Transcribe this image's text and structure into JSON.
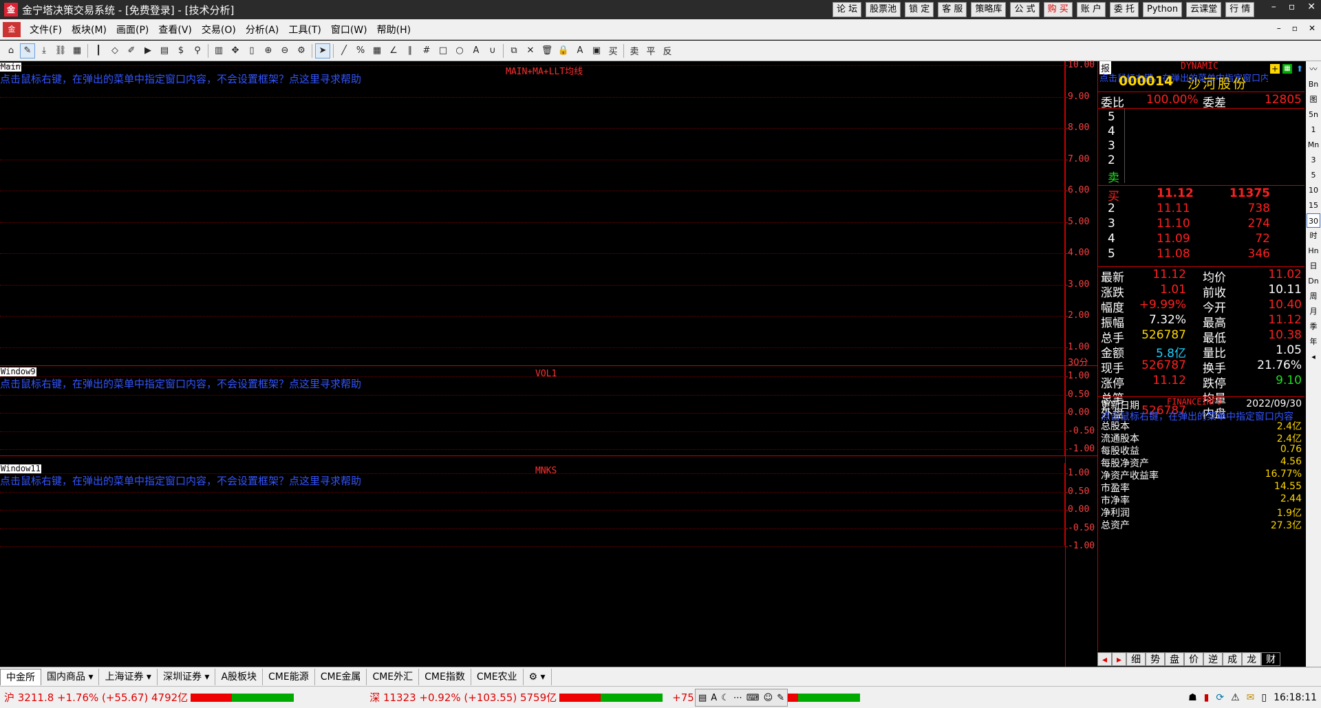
{
  "titlebar": {
    "logo_icon": "app-logo-icon",
    "title": "金宁塔决策交易系统 - [免费登录] - [技术分析]",
    "buttons": [
      "论 坛",
      "股票池",
      "锁 定",
      "客 服",
      "策略库",
      "公 式",
      "购 买",
      "账 户",
      "委 托",
      "Python",
      "云课堂",
      "行 情"
    ],
    "window_controls": [
      "–",
      "▫",
      "✕"
    ]
  },
  "menubar": {
    "items": [
      "文件(F)",
      "板块(M)",
      "画面(P)",
      "查看(V)",
      "交易(O)",
      "分析(A)",
      "工具(T)",
      "窗口(W)",
      "帮助(H)"
    ],
    "controls": [
      "–",
      "▫",
      "✕"
    ]
  },
  "toolbar": {
    "icons": [
      "home-icon",
      "pencil-icon",
      "download-icon",
      "link-icon",
      "grid-icon",
      "candlestick-icon",
      "diamond-icon",
      "edit-icon",
      "play-icon",
      "doc-icon",
      "dollar-icon",
      "filter-icon",
      "table-icon",
      "move-icon",
      "ruler-icon",
      "zoom-in-icon",
      "zoom-out-icon",
      "gear-icon",
      "cursor-icon",
      "line-icon",
      "percent-icon",
      "grid2-icon",
      "angle-icon",
      "parallel-icon",
      "hash-icon",
      "rect-icon",
      "circle-icon",
      "text-icon",
      "magnet-icon",
      "copy-icon",
      "delete-icon",
      "trash-icon",
      "lock-icon",
      "color-icon",
      "save-icon",
      "buy-icon",
      "sell-icon",
      "flat-icon",
      "reverse-icon"
    ],
    "trade_labels": [
      "买",
      "卖",
      "平",
      "反"
    ]
  },
  "chart": {
    "main": {
      "window_label": "Main",
      "hint": "点击鼠标右键，在弹出的菜单中指定窗口内容，不会设置框架？点这里寻求帮助",
      "title": "MAIN+MA+LLT均线",
      "yticks": [
        "10.00",
        "9.00",
        "8.00",
        "7.00",
        "6.00",
        "5.00",
        "4.00",
        "3.00",
        "2.00",
        "1.00"
      ],
      "period": "30分"
    },
    "vol": {
      "window_label": "Window9",
      "hint": "点击鼠标右键，在弹出的菜单中指定窗口内容，不会设置框架？点这里寻求帮助",
      "title": "VOL1",
      "yticks": [
        "1.00",
        "0.50",
        "0.00",
        "-0.50",
        "-1.00"
      ]
    },
    "mnks": {
      "window_label": "Window11",
      "hint": "点击鼠标右键，在弹出的菜单中指定窗口内容，不会设置框架？点这里寻求帮助",
      "title": "MNKS",
      "yticks": [
        "1.00",
        "0.50",
        "0.00",
        "-0.50",
        "-1.00"
      ]
    }
  },
  "quote": {
    "header_label": "DYNAMIC",
    "overlay_hint": "点击鼠标右键，在弹出的菜单中指定窗口内容",
    "code": "000014",
    "name": "沙河股份",
    "weibi_label": "委比",
    "weibi": "100.00%",
    "weicha_label": "委差",
    "weicha": "12805",
    "sell_levels": [
      "5",
      "4",
      "3",
      "2",
      "卖"
    ],
    "buy": [
      {
        "level": "买",
        "price": "11.12",
        "vol": "11375"
      },
      {
        "level": "2",
        "price": "11.11",
        "vol": "738"
      },
      {
        "level": "3",
        "price": "11.10",
        "vol": "274"
      },
      {
        "level": "4",
        "price": "11.09",
        "vol": "72"
      },
      {
        "level": "5",
        "price": "11.08",
        "vol": "346"
      }
    ],
    "stats": [
      {
        "l1": "最新",
        "v1": "11.12",
        "c1": "red",
        "l2": "均价",
        "v2": "11.02",
        "c2": "red"
      },
      {
        "l1": "涨跌",
        "v1": "1.01",
        "c1": "red",
        "l2": "前收",
        "v2": "10.11",
        "c2": "white"
      },
      {
        "l1": "幅度",
        "v1": "+9.99%",
        "c1": "red",
        "l2": "今开",
        "v2": "10.40",
        "c2": "red"
      },
      {
        "l1": "振幅",
        "v1": "7.32%",
        "c1": "white",
        "l2": "最高",
        "v2": "11.12",
        "c2": "red"
      },
      {
        "l1": "总手",
        "v1": "526787",
        "c1": "yellow",
        "l2": "最低",
        "v2": "10.38",
        "c2": "red"
      },
      {
        "l1": "金额",
        "v1": "5.8亿",
        "c1": "cyan",
        "l2": "量比",
        "v2": "1.05",
        "c2": "white"
      },
      {
        "l1": "现手",
        "v1": "526787",
        "c1": "red",
        "l2": "换手",
        "v2": "21.76%",
        "c2": "white"
      },
      {
        "l1": "涨停",
        "v1": "11.12",
        "c1": "red",
        "l2": "跌停",
        "v2": "9.10",
        "c2": "green"
      },
      {
        "l1": "总笔",
        "v1": "",
        "c1": "white",
        "l2": "均量",
        "v2": "",
        "c2": "white"
      },
      {
        "l1": "外盘",
        "v1": "526787",
        "c1": "red",
        "l2": "内盘",
        "v2": "",
        "c2": "white"
      }
    ]
  },
  "finance": {
    "header": "FINANCEINFO",
    "overlay_hint": "点击鼠标右键，在弹出的菜单中指定窗口内容",
    "update_label": "更新日期",
    "update_date": "2022/09/30",
    "rows": [
      {
        "label": "总股本",
        "value": "2.4亿"
      },
      {
        "label": "流通股本",
        "value": "2.4亿"
      },
      {
        "label": "每股收益",
        "value": "0.76"
      },
      {
        "label": "每股净资产",
        "value": "4.56"
      },
      {
        "label": "净资产收益率",
        "value": "16.77%"
      },
      {
        "label": "市盈率",
        "value": "14.55"
      },
      {
        "label": "市净率",
        "value": "2.44"
      },
      {
        "label": "净利润",
        "value": "1.9亿"
      },
      {
        "label": "总资产",
        "value": "27.3亿"
      }
    ]
  },
  "right_vtabs": [
    "〰",
    "Bn",
    "图",
    "5n",
    "1",
    "Mn",
    "3",
    "5",
    "10",
    "15",
    "30",
    "时",
    "Hn",
    "日",
    "Dn",
    "周",
    "月",
    "季",
    "年",
    "◂"
  ],
  "right_htabs": [
    "细",
    "势",
    "盘",
    "价",
    "逆",
    "成",
    "龙",
    "财"
  ],
  "bottom_tabs": [
    "中金所",
    "国内商品 ▾",
    "上海证券 ▾",
    "深圳证券 ▾",
    "A股板块",
    "CME能源",
    "CME金属",
    "CME外汇",
    "CME指数",
    "CME农业"
  ],
  "statusbar": {
    "sh": "沪 3211.8 +1.76% (+55.67) 4792亿",
    "sh_red_pct": 40,
    "sz": "深 11323 +0.92% (+103.55) 5759亿",
    "sz_red_pct": 40,
    "cy": "+75.93) 2966亿",
    "cy_red_pct": 40,
    "time": "16:18:11"
  },
  "colors": {
    "grid": "#7a0000",
    "axis": "#ff4040",
    "hint": "#3355ff",
    "up": "#ff2020",
    "down": "#20e020"
  }
}
